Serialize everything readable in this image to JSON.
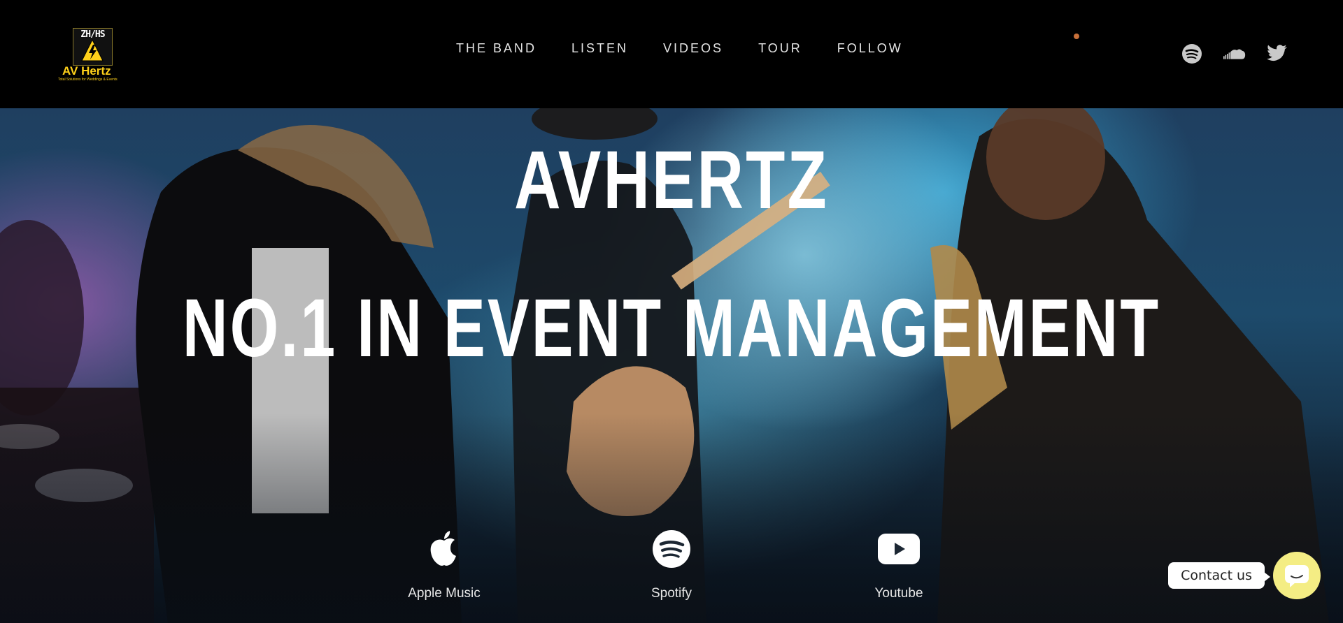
{
  "logo": {
    "badge_text": "ZH/HS",
    "name": "AV Hertz",
    "tagline": "Total Solutions for Weddings & Events"
  },
  "nav": {
    "items": [
      {
        "label": "THE BAND"
      },
      {
        "label": "LISTEN"
      },
      {
        "label": "VIDEOS"
      },
      {
        "label": "TOUR"
      },
      {
        "label": "FOLLOW"
      }
    ]
  },
  "socials": [
    {
      "icon": "spotify-icon"
    },
    {
      "icon": "soundcloud-icon"
    },
    {
      "icon": "twitter-icon"
    }
  ],
  "hero": {
    "title_line1": "AVHERTZ",
    "title_line2": "NO.1 IN EVENT MANAGEMENT"
  },
  "platforms": [
    {
      "label": "Apple Music",
      "icon": "apple-icon"
    },
    {
      "label": "Spotify",
      "icon": "spotify-icon"
    },
    {
      "label": "Youtube",
      "icon": "youtube-icon"
    }
  ],
  "contact": {
    "label": "Contact us"
  },
  "colors": {
    "accent_yellow": "#ffd11a",
    "contact_button": "#f4ed84",
    "header_bg": "#000000"
  }
}
